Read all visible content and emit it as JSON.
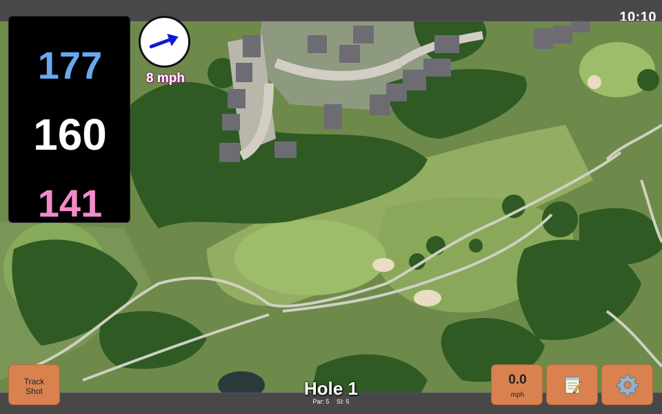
{
  "status": {
    "time": "10:10"
  },
  "distances": {
    "back": "177",
    "middle": "160",
    "front": "141"
  },
  "wind": {
    "speed": "8 mph",
    "direction_deg": -20,
    "icon": "wind-arrow-icon"
  },
  "buttons": {
    "track_shot": {
      "line1": "Track",
      "line2": "Shot"
    },
    "speed": {
      "value": "0.0",
      "unit": "mph"
    },
    "notes": {
      "icon": "notepad-icon"
    },
    "settings": {
      "icon": "gear-icon"
    }
  },
  "hole": {
    "title": "Hole 1",
    "par": "Par: 5",
    "si": "SI: 5"
  },
  "colors": {
    "back": "#66aaee",
    "middle": "#ffffff",
    "front": "#f08cc8",
    "button": "#d9824f",
    "wind_arrow": "#1018d8"
  }
}
